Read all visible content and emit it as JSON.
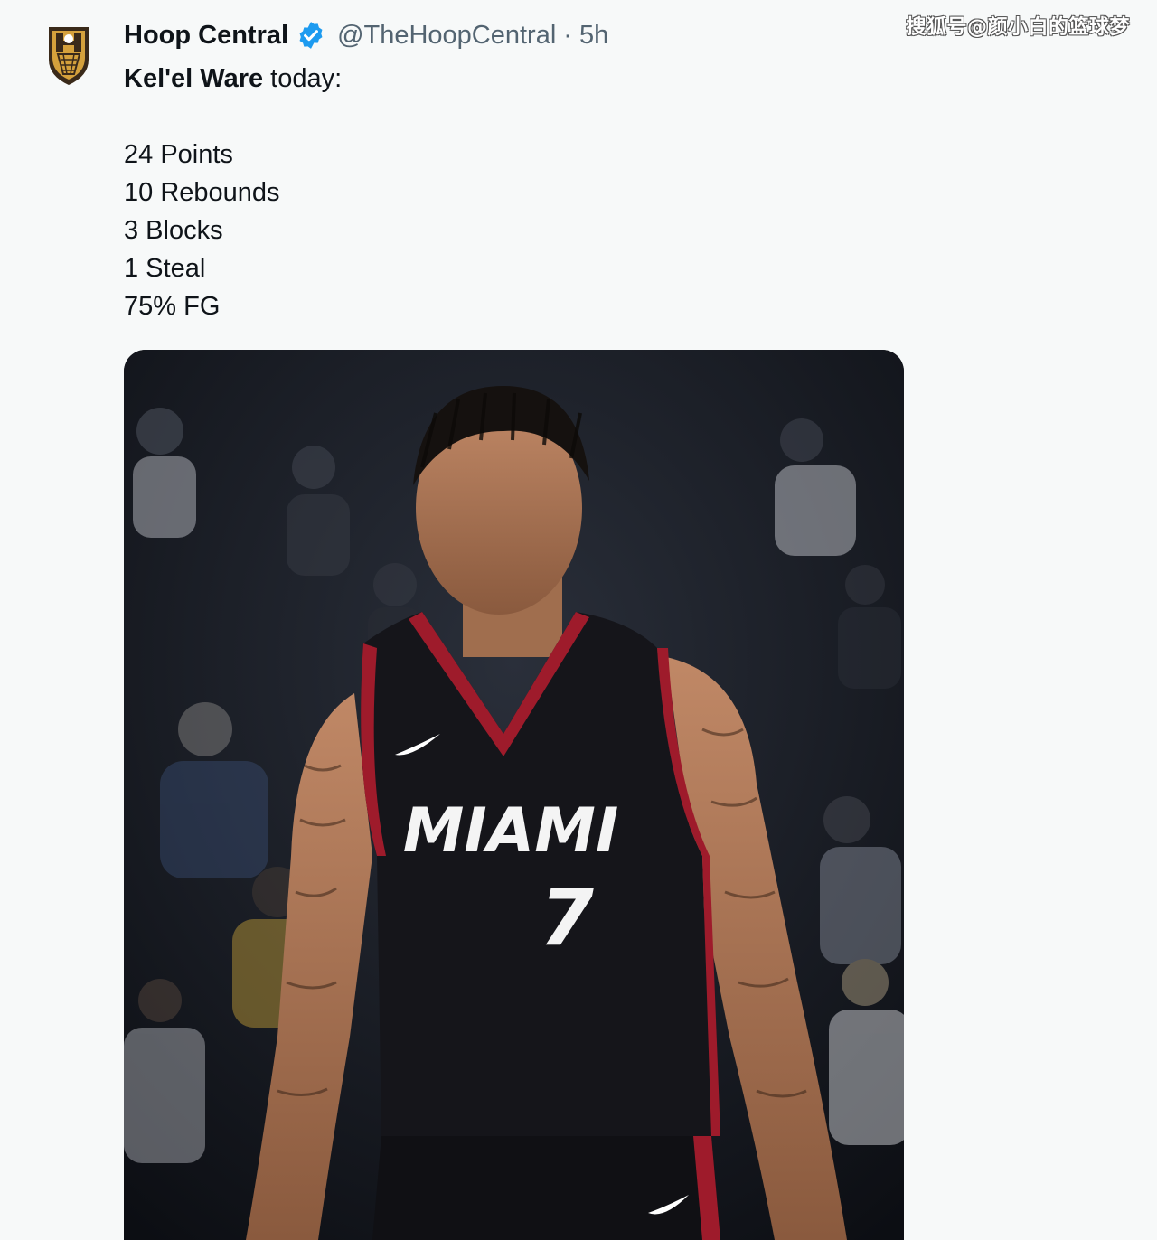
{
  "watermark": "搜狐号@颜小白的篮球梦",
  "tweet": {
    "author_name": "Hoop Central",
    "handle": "@TheHoopCentral",
    "separator": "·",
    "time": "5h",
    "player_name": "Kel'el Ware",
    "text_suffix": " today:",
    "stats": [
      "24 Points",
      "10 Rebounds",
      "3 Blocks",
      "1 Steal",
      "75% FG"
    ]
  },
  "media": {
    "jersey_team": "MIAMI",
    "jersey_number": "7"
  },
  "colors": {
    "accent_blue": "#1d9bf0",
    "text_primary": "#0f1419",
    "text_secondary": "#536471",
    "jersey_black": "#15151a",
    "jersey_red": "#9e1b2b",
    "logo_gold": "#d5a13c"
  }
}
